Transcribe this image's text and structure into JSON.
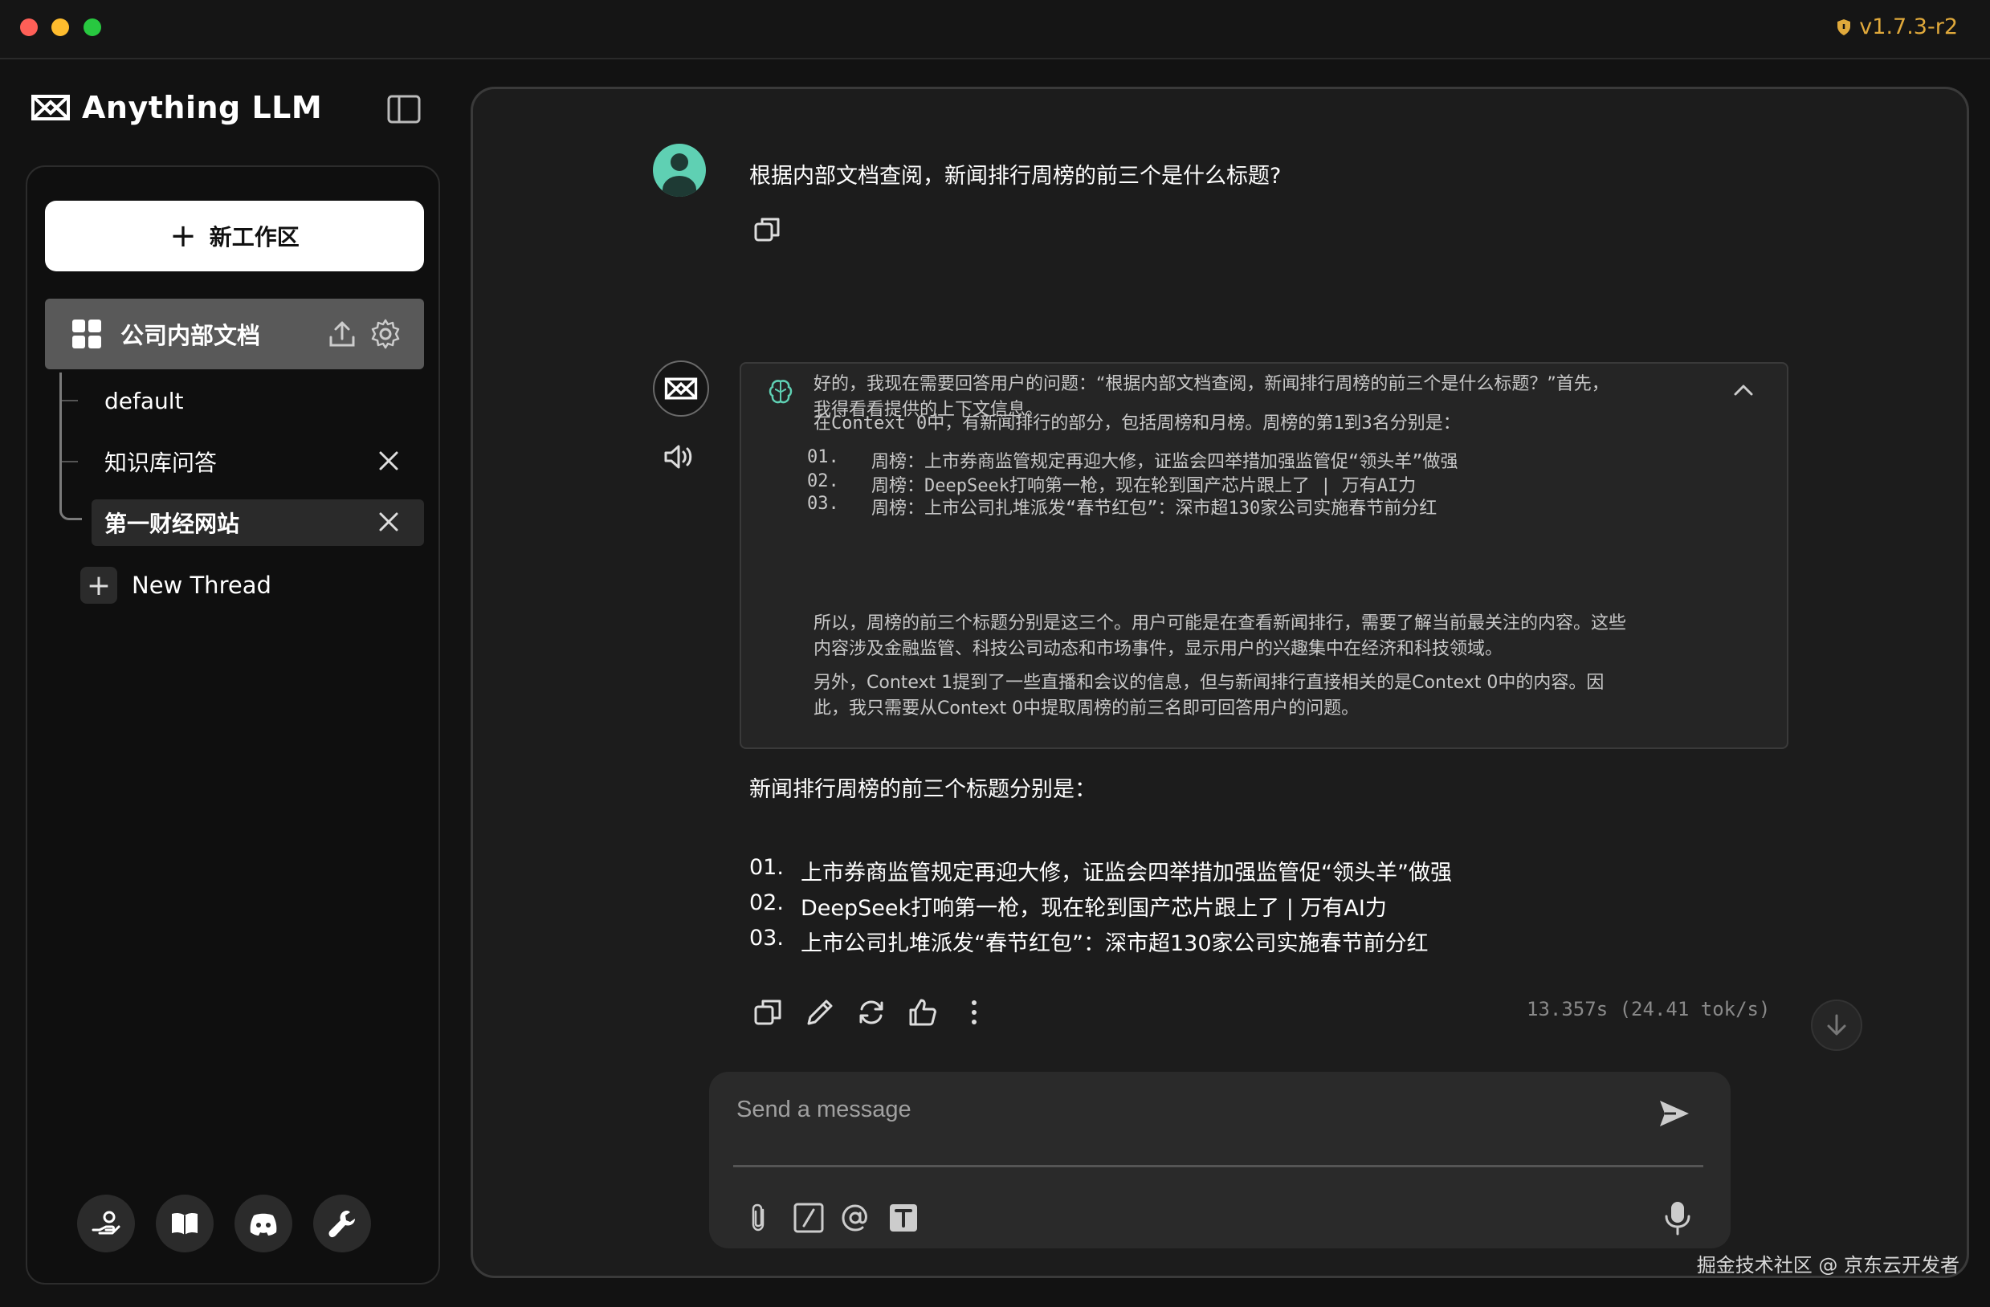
{
  "window": {
    "version": "v1.7.3-r2",
    "watermark": "掘金技术社区 @ 京东云开发者"
  },
  "app": {
    "name": "Anything LLM"
  },
  "sidebar": {
    "new_workspace_label": "新工作区",
    "workspace_name": "公司内部文档",
    "threads": [
      {
        "label": "default",
        "active": false
      },
      {
        "label": "知识库问答",
        "active": false
      },
      {
        "label": "第一财经网站",
        "active": true
      }
    ],
    "new_thread_label": "New Thread"
  },
  "chat": {
    "user_message": "根据内部文档查阅，新闻排行周榜的前三个是什么标题?",
    "thought": {
      "p1_line1": "好的，我现在需要回答用户的问题：“根据内部文档查阅，新闻排行周榜的前三个是什么标题？”首先，",
      "p1_line2": "我得看看提供的上下文信息。",
      "p2": "在Context 0中，有新闻排行的部分，包括周榜和月榜。周榜的第1到3名分别是：",
      "items": [
        {
          "num": "01.",
          "text": "周榜：上市券商监管规定再迎大修，证监会四举措加强监管促“领头羊”做强"
        },
        {
          "num": "02.",
          "text": "周榜：DeepSeek打响第一枪，现在轮到国产芯片跟上了 | 万有AI力"
        },
        {
          "num": "03.",
          "text": "周榜：上市公司扎堆派发“春节红包”：深市超130家公司实施春节前分红"
        }
      ],
      "p3_line1": "所以，周榜的前三个标题分别是这三个。用户可能是在查看新闻排行，需要了解当前最关注的内容。这些",
      "p3_line2": "内容涉及金融监管、科技公司动态和市场事件，显示用户的兴趣集中在经济和科技领域。",
      "p4_line1": "另外，Context 1提到了一些直播和会议的信息，但与新闻排行直接相关的是Context 0中的内容。因",
      "p4_line2": "此，我只需要从Context 0中提取周榜的前三名即可回答用户的问题。"
    },
    "answer_intro": "新闻排行周榜的前三个标题分别是：",
    "answer_items": [
      {
        "num": "01.",
        "text": "上市券商监管规定再迎大修，证监会四举措加强监管促“领头羊”做强"
      },
      {
        "num": "02.",
        "text": "DeepSeek打响第一枪，现在轮到国产芯片跟上了 | 万有AI力"
      },
      {
        "num": "03.",
        "text": "上市公司扎堆派发“春节红包”：深市超130家公司实施春节前分红"
      }
    ],
    "timing": "13.357s (24.41 tok/s)"
  },
  "composer": {
    "placeholder": "Send a message"
  },
  "colors": {
    "version_accent": "#e0a93b",
    "user_avatar": "#5fd0b3",
    "active_workspace": "#595959"
  }
}
